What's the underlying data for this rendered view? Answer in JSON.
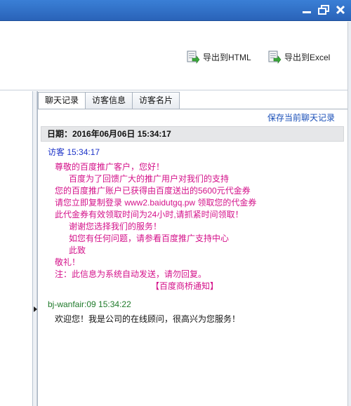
{
  "toolbar": {
    "export_html": "导出到HTML",
    "export_excel": "导出到Excel"
  },
  "tabs": [
    {
      "label": "聊天记录"
    },
    {
      "label": "访客信息"
    },
    {
      "label": "访客名片"
    }
  ],
  "save_link": "保存当前聊天记录",
  "date_label": "日期：2016年06月06日 15:34:17",
  "messages": [
    {
      "sender": "访客 15:34:17",
      "lines": [
        "尊敬的百度推广客户，您好！",
        "百度为了回馈广大的推广用户对我们的支持",
        "您的百度推广账户已获得由百度送出的5600元代金券",
        "请您立即复制登录 www2.baidutgq.pw 领取您的代金券",
        "此代金券有效领取时间为24小时,请抓紧时间领取！",
        "谢谢您选择我们的服务！",
        "如您有任何问题，请参看百度推广支持中心",
        "此致",
        "敬礼！",
        "注：此信息为系统自动发送，请勿回复。",
        "【百度商桥通知】"
      ]
    },
    {
      "sender": "bj-wanfair:09 15:34:22",
      "text": "欢迎您！我是公司的在线顾问，很高兴为您服务！"
    }
  ],
  "colors": {
    "titlebar": "#2f6fc8",
    "visitor_name": "#1c33c8",
    "agent_name": "#1f7a2a",
    "message_text": "#d4128a",
    "link": "#1a4fb8"
  }
}
